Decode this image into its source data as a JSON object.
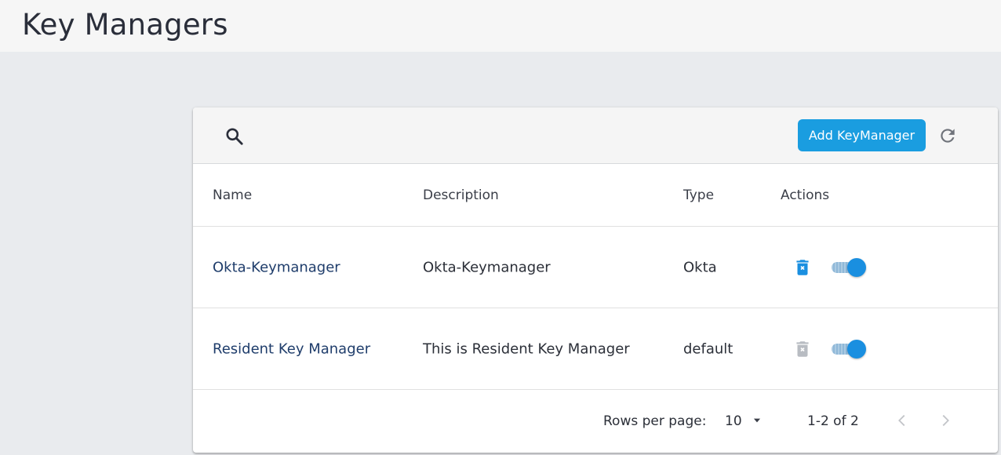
{
  "page": {
    "title": "Key Managers"
  },
  "toolbar": {
    "add_label": "Add KeyManager",
    "search_icon": "search-icon",
    "refresh_icon": "refresh-icon"
  },
  "colors": {
    "accent": "#1a9de0",
    "link": "#1f3d6b",
    "toggle_thumb": "#1a8fe0",
    "trash_active": "#1a8fe0",
    "trash_disabled": "#b8bcc2"
  },
  "table": {
    "headers": {
      "name": "Name",
      "description": "Description",
      "type": "Type",
      "actions": "Actions"
    },
    "rows": [
      {
        "name": "Okta-Keymanager",
        "description": "Okta-Keymanager",
        "type": "Okta",
        "delete_enabled": true,
        "enabled": true
      },
      {
        "name": "Resident Key Manager",
        "description": "This is Resident Key Manager",
        "type": "default",
        "delete_enabled": false,
        "enabled": true
      }
    ]
  },
  "pagination": {
    "rows_label": "Rows per page:",
    "rows_value": "10",
    "range": "1-2 of 2"
  }
}
